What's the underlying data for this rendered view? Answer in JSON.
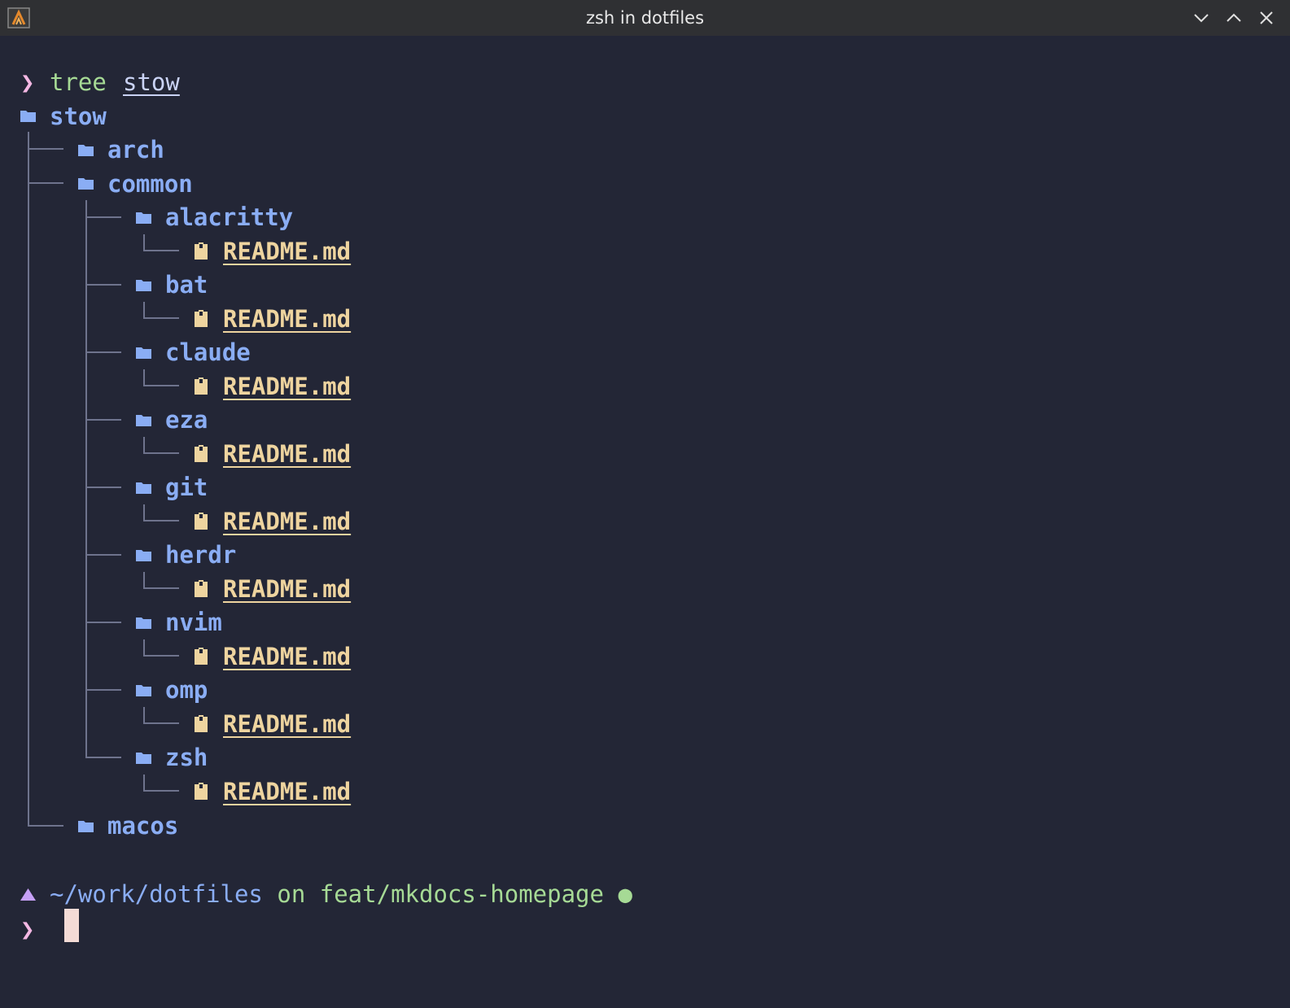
{
  "window": {
    "title": "zsh in dotfiles",
    "app_icon": "alacritty-icon",
    "controls": [
      "minimize-icon",
      "maximize-icon",
      "close-icon"
    ]
  },
  "terminal": {
    "command": {
      "prompt_symbol": "❯",
      "program": "tree",
      "argument": "stow"
    },
    "tree": {
      "root": "stow",
      "l1": [
        "arch",
        "common",
        "macos"
      ],
      "common_children": [
        {
          "dir": "alacritty",
          "file": "README.md"
        },
        {
          "dir": "bat",
          "file": "README.md"
        },
        {
          "dir": "claude",
          "file": "README.md"
        },
        {
          "dir": "eza",
          "file": "README.md"
        },
        {
          "dir": "git",
          "file": "README.md"
        },
        {
          "dir": "herdr",
          "file": "README.md"
        },
        {
          "dir": "nvim",
          "file": "README.md"
        },
        {
          "dir": "omp",
          "file": "README.md"
        },
        {
          "dir": "zsh",
          "file": "README.md"
        }
      ]
    },
    "status": {
      "path": "~/work/dotfiles",
      "on": "on",
      "branch_icon": "",
      "branch": "feat/mkdocs-homepage",
      "dirty_indicator": "●"
    },
    "next_prompt": "❯"
  },
  "colors": {
    "background": "#232636",
    "titlebar": "#2f3033",
    "directory": "#8aadf4",
    "file": "#eed49f",
    "command": "#a6da95",
    "prompt": "#f4b8e4",
    "cursor": "#f4dbd6"
  }
}
